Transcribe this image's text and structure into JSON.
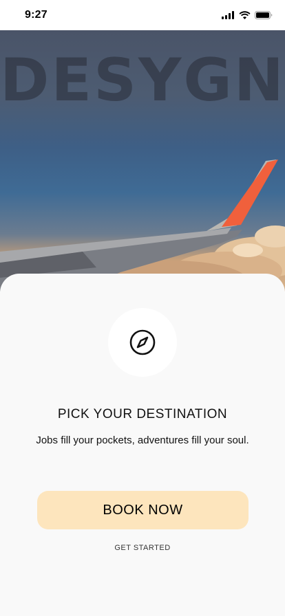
{
  "status_bar": {
    "time": "9:27",
    "icons": [
      "signal-icon",
      "wifi-icon",
      "battery-icon"
    ]
  },
  "hero": {
    "brand_text": "DESYGN",
    "image": "airplane-wing-above-clouds"
  },
  "onboarding": {
    "icon": "compass-icon",
    "title": "PICK YOUR DESTINATION",
    "subtitle": "Jobs fill your pockets, adventures fill your soul.",
    "primary_button_label": "BOOK NOW",
    "secondary_link_label": "GET STARTED"
  },
  "colors": {
    "button_background": "#fde5bd",
    "sheet_background": "#f9f9f9",
    "wing_tip": "#f0603c"
  }
}
